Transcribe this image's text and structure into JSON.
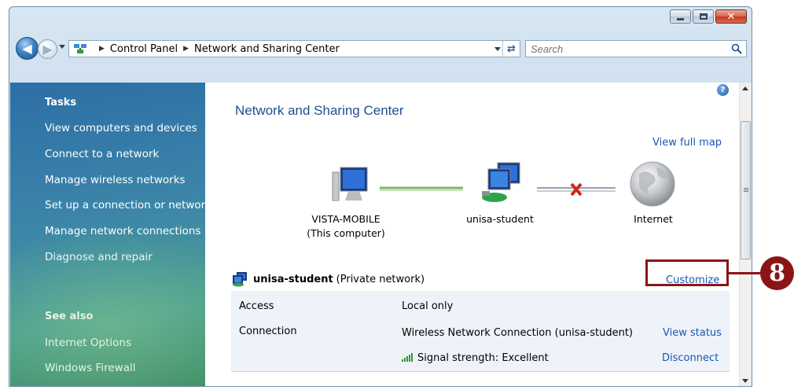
{
  "window": {
    "caption_buttons": [
      "minimize-icon",
      "maximize-icon",
      "close-icon"
    ],
    "close_glyph": "✕"
  },
  "address_bar": {
    "crumbs": [
      "Control Panel",
      "Network and Sharing Center"
    ],
    "search_placeholder": "Search"
  },
  "sidebar": {
    "tasks_heading": "Tasks",
    "tasks": [
      "View computers and devices",
      "Connect to a network",
      "Manage wireless networks",
      "Set up a connection or network",
      "Manage network connections",
      "Diagnose and repair"
    ],
    "see_also_heading": "See also",
    "see_also": [
      "Internet Options",
      "Windows Firewall"
    ]
  },
  "main": {
    "title": "Network and Sharing Center",
    "view_full_map": "View full map",
    "map": {
      "computer_name": "VISTA-MOBILE",
      "computer_subtitle": "(This computer)",
      "network_name": "unisa-student",
      "internet_label": "Internet"
    },
    "network": {
      "name": "unisa-student",
      "type": "(Private network)",
      "customize": "Customize"
    },
    "details": {
      "access_label": "Access",
      "access_value": "Local only",
      "connection_label": "Connection",
      "connection_value": "Wireless Network Connection (unisa-student)",
      "view_status": "View status",
      "signal_text": "Signal strength:  Excellent",
      "disconnect": "Disconnect"
    }
  },
  "callout": {
    "number": "8"
  },
  "colors": {
    "callout": "#8b1516",
    "link": "#1a56b5",
    "title": "#1f4f8f"
  }
}
